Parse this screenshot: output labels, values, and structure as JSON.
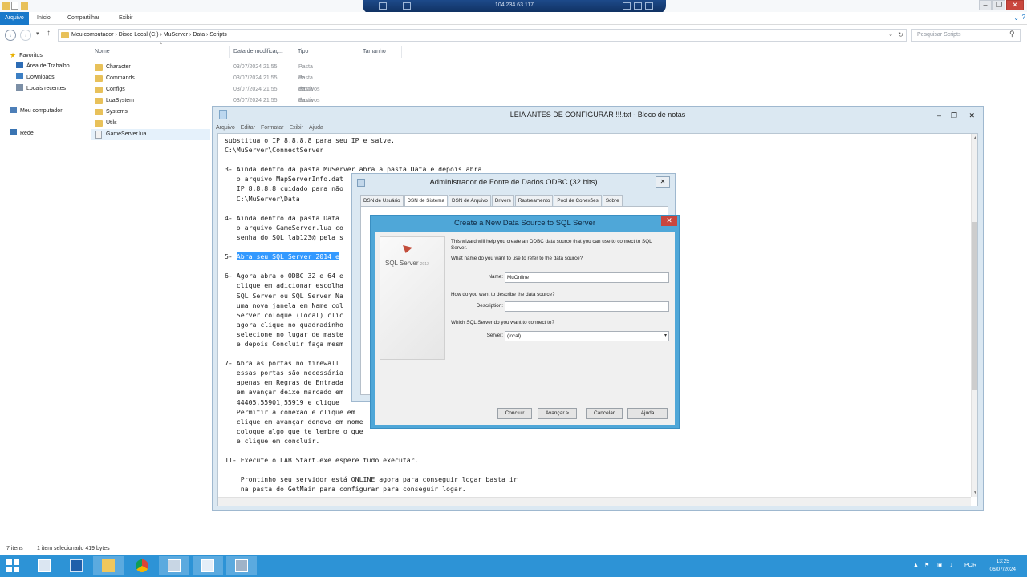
{
  "explorer": {
    "ribbon_tabs": [
      "Arquivo",
      "Início",
      "Compartilhar",
      "Exibir"
    ],
    "rdp_host": "104.234.63.117",
    "breadcrumb": "Meu computador  ›  Disco Local (C:)  ›  MuServer  ›  Data  ›  Scripts",
    "search_placeholder": "Pesquisar Scripts",
    "sidebar": {
      "favorites": "Favoritos",
      "desktop": "Área de Trabalho",
      "downloads": "Downloads",
      "recent": "Locais recentes",
      "computer": "Meu computador",
      "network": "Rede"
    },
    "columns": [
      "Nome",
      "Data de modificaç...",
      "Tipo",
      "Tamanho"
    ],
    "files": [
      {
        "name": "Character",
        "date": "03/07/2024 21:55",
        "type": "Pasta de arquivos"
      },
      {
        "name": "Commands",
        "date": "03/07/2024 21:55",
        "type": "Pasta de arquivos"
      },
      {
        "name": "Configs",
        "date": "03/07/2024 21:55",
        "type": "Pasta de arquivos"
      },
      {
        "name": "LuaSystem",
        "date": "03/07/2024 21:55",
        "type": "Pasta de arquivos"
      },
      {
        "name": "Systems",
        "date": "",
        "type": ""
      },
      {
        "name": "Utils",
        "date": "",
        "type": ""
      },
      {
        "name": "GameServer.lua",
        "date": "",
        "type": ""
      }
    ],
    "status": {
      "count": "7 itens",
      "selected": "1 item selecionado  419 bytes"
    }
  },
  "notepad": {
    "title": "LEIA ANTES DE CONFIGURAR !!!.txt - Bloco de notas",
    "menu": [
      "Arquivo",
      "Editar",
      "Formatar",
      "Exibir",
      "Ajuda"
    ],
    "lines": [
      "substitua o IP 8.8.8.8 para seu IP e salve.",
      "C:\\MuServer\\ConnectServer",
      "",
      "3- Ainda dentro da pasta MuServer abra a pasta Data e depois abra",
      "   o arquivo MapServerInfo.dat",
      "   IP 8.8.8.8 cuidado para não",
      "   C:\\MuServer\\Data",
      "",
      "4- Ainda dentro da pasta Data",
      "   o arquivo GameServer.lua co",
      "   senha do SQL lab123@ pela s",
      "",
      "5- ",
      "",
      "6- Agora abra o ODBC 32 e 64 e",
      "   clique em adicionar escolha",
      "   SQL Server ou SQL Server Na",
      "   uma nova janela em Name col",
      "   Server coloque (local) clic",
      "   agora clique no quadradinho",
      "   selecione no lugar de maste",
      "   e depois Concluir faça mesm",
      "",
      "7- Abra as portas no firewall",
      "   essas portas são necessária",
      "   apenas em Regras de Entrada",
      "   em avançar deixe marcado em",
      "   44405,55901,55919 e clique",
      "   Permitir a conexão e clique em",
      "   clique em avançar denovo em nome",
      "   coloque algo que te lembre o que",
      "   e clique em concluir.",
      "",
      "11- Execute o LAB Start.exe espere tudo executar.",
      "",
      "    Prontinho seu servidor está ONLINE agora para conseguir logar basta ir",
      "    na pasta do GetMain para configurar para conseguir logar."
    ],
    "highlight": "Abra seu SQL Server 2014 e"
  },
  "odbc": {
    "title": "Administrador de Fonte de Dados ODBC (32 bits)",
    "tabs": [
      "DSN de Usuário",
      "DSN de Sistema",
      "DSN de Arquivo",
      "Drivers",
      "Rastreamento",
      "Pool de Conexões",
      "Sobre"
    ]
  },
  "wizard": {
    "title": "Create a New Data Source to SQL Server",
    "logo": "SQL Server",
    "logo_year": "2012",
    "intro": "This wizard will help you create an ODBC data source that you can use to connect to SQL Server.",
    "q_name": "What name do you want to use to refer to the data source?",
    "name_label": "Name:",
    "name_value": "MuOnline",
    "q_desc": "How do you want to describe the data source?",
    "desc_label": "Description:",
    "desc_value": "",
    "q_server": "Which SQL Server do you want to connect to?",
    "server_label": "Server:",
    "server_value": "(local)",
    "buttons": {
      "finish": "Concluir",
      "next": "Avançar >",
      "cancel": "Cancelar",
      "help": "Ajuda"
    }
  },
  "taskbar": {
    "lang": "POR",
    "time": "13:25",
    "date": "06/07/2024"
  },
  "colors": {
    "taskbar": "#2d93d6",
    "wizard_frame": "#4fa7d8",
    "selection": "#3399ff",
    "close": "#c9463d"
  }
}
